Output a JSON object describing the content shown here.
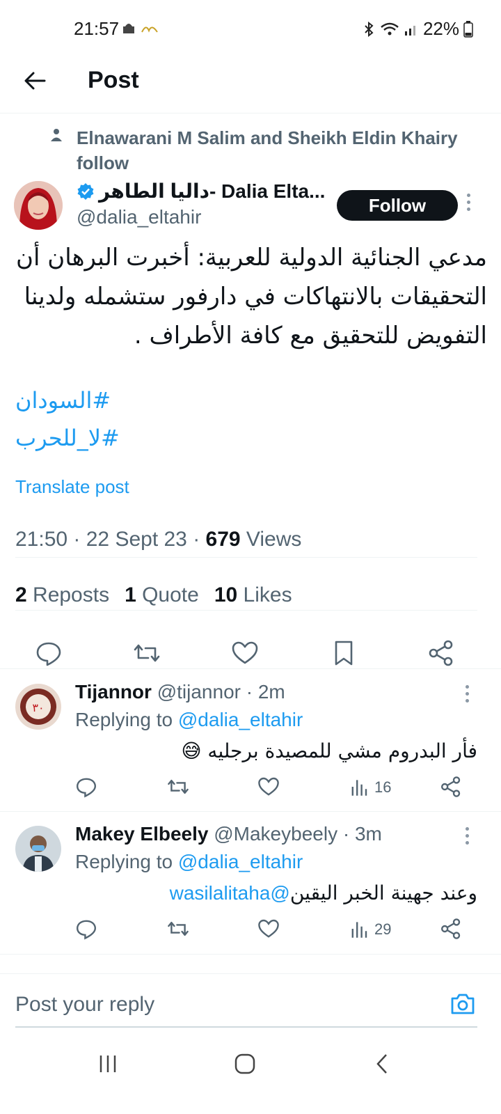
{
  "status_bar": {
    "time": "21:57",
    "battery": "22%"
  },
  "header": {
    "title": "Post"
  },
  "social_context": "Elnawarani M Salim and Sheikh Eldin Khairy follow",
  "post": {
    "author_name": "داليا الطاهر- Dalia Elta...",
    "author_handle": "@dalia_eltahir",
    "follow_label": "Follow",
    "text": "مدعي الجنائية الدولية للعربية: أخبرت البرهان أن التحقيقات بالانتهاكات في دارفور ستشمله  ولدينا التفويض  للتحقيق مع كافة الأطراف .",
    "hashtags": [
      "#السودان",
      "#لا_للحرب"
    ],
    "translate_label": "Translate post",
    "timestamp": "21:50 · 22 Sept 23 · ",
    "views_count": "679",
    "views_label": " Views",
    "reposts_count": "2",
    "reposts_label": " Reposts",
    "quotes_count": "1",
    "quotes_label": " Quote",
    "likes_count": "10",
    "likes_label": " Likes"
  },
  "replies": [
    {
      "name": "Tijannor",
      "meta": " @tijannor · 2m",
      "replying_prefix": "Replying to ",
      "replying_handle": "@dalia_eltahir",
      "text": "فأر البدروم مشي للمصيدة برجليه 😅",
      "views": "16",
      "avatar_color": "#7a2b23"
    },
    {
      "name": "Makey Elbeely",
      "meta": " @Makeybeely · 3m",
      "replying_prefix": "Replying to ",
      "replying_handle": "@dalia_eltahir",
      "mention": "@wasilalitaha",
      "text": " وعند جهينة الخبر اليقين",
      "views": "29",
      "avatar_color": "#6b7c8a"
    }
  ],
  "reply_bar": {
    "placeholder": "Post your reply"
  },
  "colors": {
    "accent": "#1d9bf0",
    "text": "#0f1419",
    "secondary": "#536471"
  },
  "icons": [
    "back-arrow-icon",
    "verified-badge-icon",
    "comment-icon",
    "repost-icon",
    "like-icon",
    "bookmark-icon",
    "share-icon",
    "views-icon",
    "camera-icon"
  ]
}
